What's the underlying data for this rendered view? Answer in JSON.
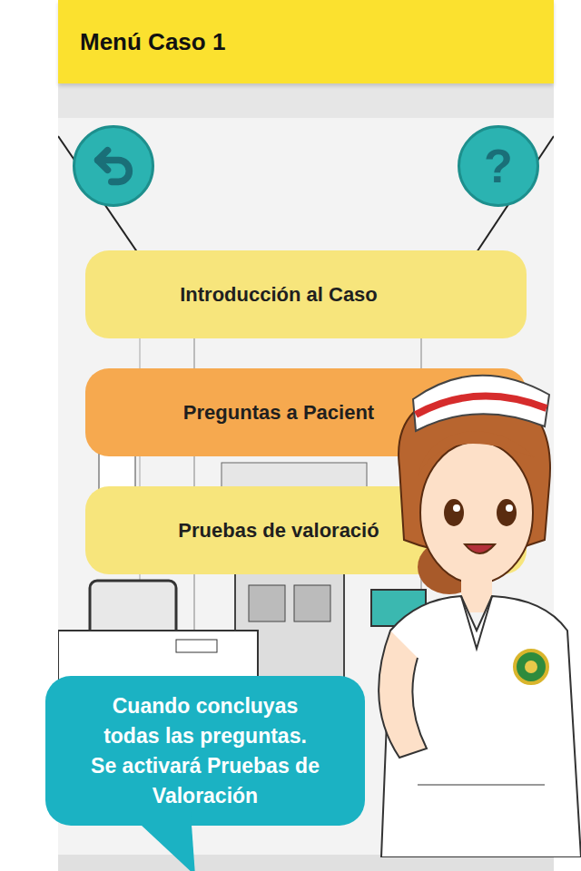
{
  "header": {
    "title": "Menú Caso 1"
  },
  "help_button": {
    "label": "?"
  },
  "menu": [
    {
      "label": "Introducción al Caso",
      "color": "#f7e57c"
    },
    {
      "label": "Preguntas a Pacient",
      "color": "#f6a94f"
    },
    {
      "label": "Pruebas de valoració",
      "color": "#f7e57c"
    }
  ],
  "speech_bubble": {
    "lines": [
      "Cuando concluyas",
      "todas las preguntas.",
      "Se activará Pruebas de",
      "Valoración"
    ]
  }
}
